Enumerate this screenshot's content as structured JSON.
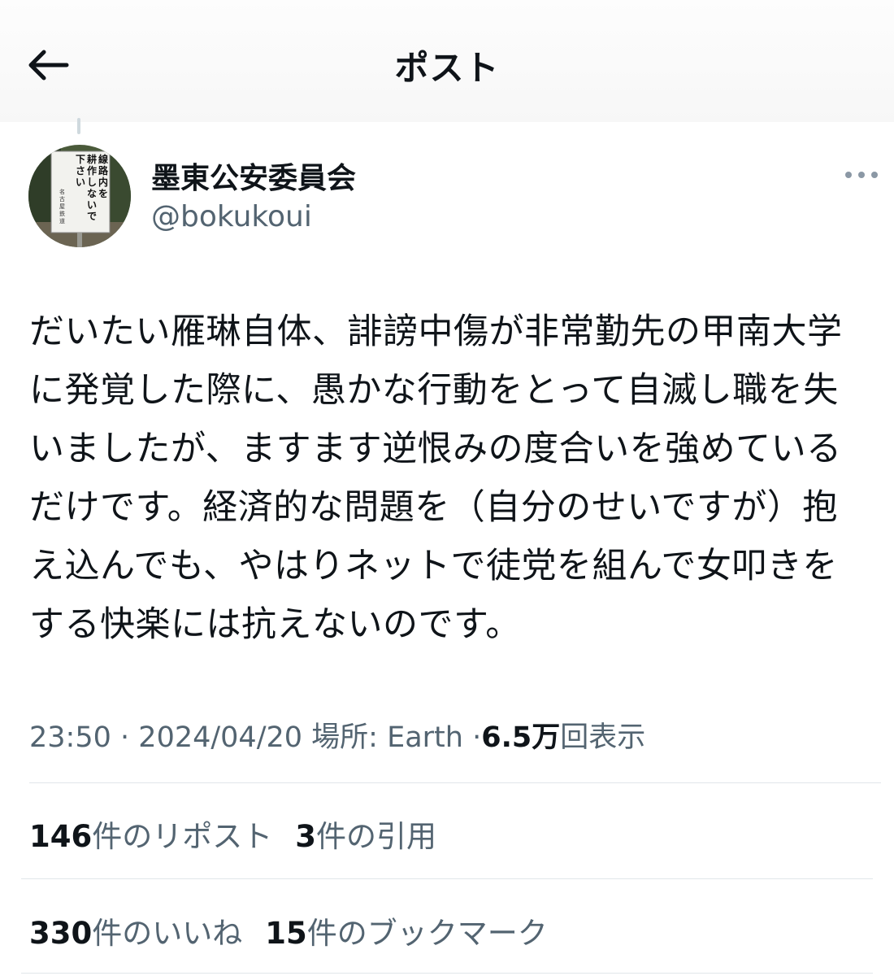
{
  "header": {
    "title": "ポスト"
  },
  "author": {
    "display_name": "墨東公安委員会",
    "handle": "@bokukoui",
    "avatar_sign_text": "線路内を耕作しないで下さい",
    "avatar_sign_small": "名古屋鉄道"
  },
  "tweet": {
    "text": "だいたい雁琳自体、誹謗中傷が非常勤先の甲南大学\nに発覚した際に、愚かな行動をとって自滅し職を失\nいましたが、ますます逆恨みの度合いを強めている\nだけです。経済的な問題を（自分のせいですが）抱\nえ込んでも、やはりネットで徒党を組んで女叩きを\nする快楽には抗えないのです。"
  },
  "meta": {
    "time": "23:50",
    "sep1": "·",
    "date": "2024/04/20",
    "location": "場所: Earth",
    "sep2": "·",
    "views_count": "6.5",
    "views_unit": "万",
    "views_label": "回表示"
  },
  "stats": {
    "reposts_count": "146",
    "reposts_label": "件のリポスト",
    "quotes_count": "3",
    "quotes_label": "件の引用",
    "likes_count": "330",
    "likes_label": "件のいいね",
    "bookmarks_count": "15",
    "bookmarks_label": "件のブックマーク"
  },
  "icons": {
    "back": "arrow-left-icon",
    "more": "more-horizontal-icon"
  },
  "colors": {
    "text": "#0f1419",
    "secondary": "#536471",
    "divider": "#e1e6ea"
  }
}
